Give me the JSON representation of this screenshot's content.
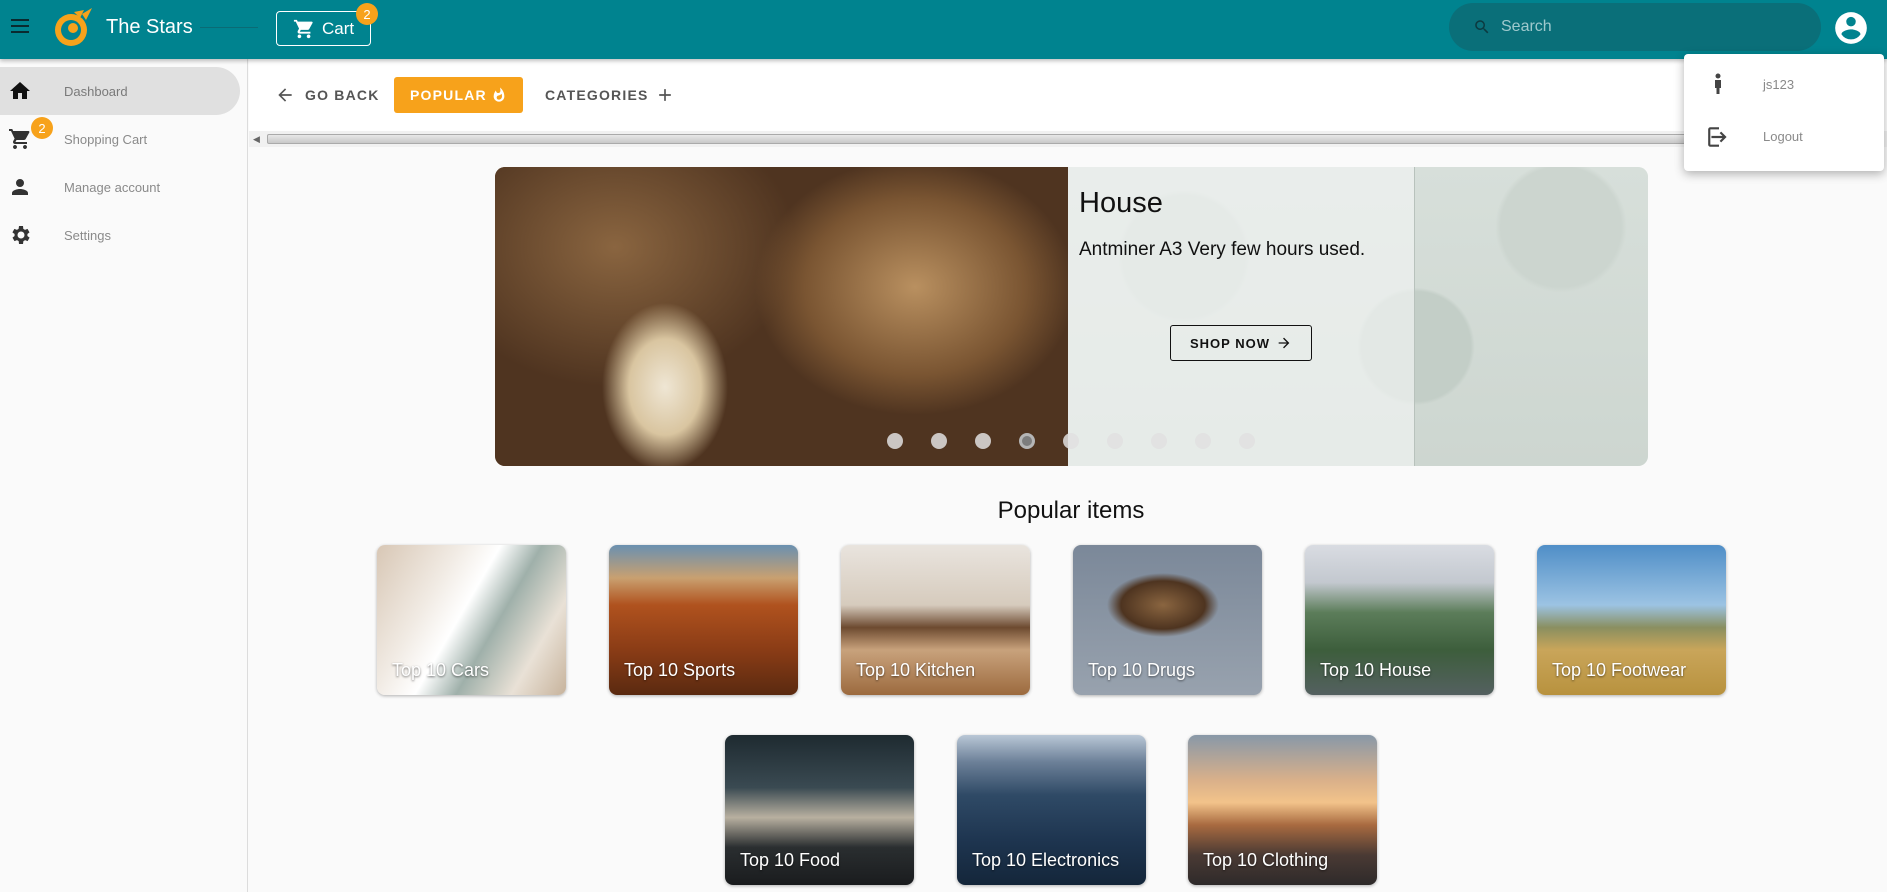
{
  "app": {
    "title": "The Stars",
    "accent": "#00838f",
    "highlight": "#f7a21b"
  },
  "header": {
    "cart_label": "Cart",
    "cart_count": "2",
    "search_placeholder": "Search"
  },
  "sidebar": {
    "items": [
      {
        "label": "Dashboard",
        "icon": "home-icon"
      },
      {
        "label": "Shopping Cart",
        "icon": "cart-icon",
        "badge": "2"
      },
      {
        "label": "Manage account",
        "icon": "person-icon"
      },
      {
        "label": "Settings",
        "icon": "gear-icon"
      }
    ]
  },
  "toolbar": {
    "go_back": "GO BACK",
    "popular": "POPULAR",
    "categories": "CATEGORIES"
  },
  "carousel": {
    "title": "House",
    "description": "Antminer A3 Very few hours used.",
    "button": "SHOP NOW",
    "dots": 9,
    "active_dot": 4
  },
  "popular": {
    "title": "Popular items",
    "cards": [
      {
        "label": "Top 10 Cars"
      },
      {
        "label": "Top 10 Sports"
      },
      {
        "label": "Top 10 Kitchen"
      },
      {
        "label": "Top 10 Drugs"
      },
      {
        "label": "Top 10 House"
      },
      {
        "label": "Top 10 Footwear"
      },
      {
        "label": "Top 10 Food"
      },
      {
        "label": "Top 10 Electronics"
      },
      {
        "label": "Top 10 Clothing"
      }
    ]
  },
  "user_menu": {
    "username": "js123",
    "logout": "Logout"
  }
}
